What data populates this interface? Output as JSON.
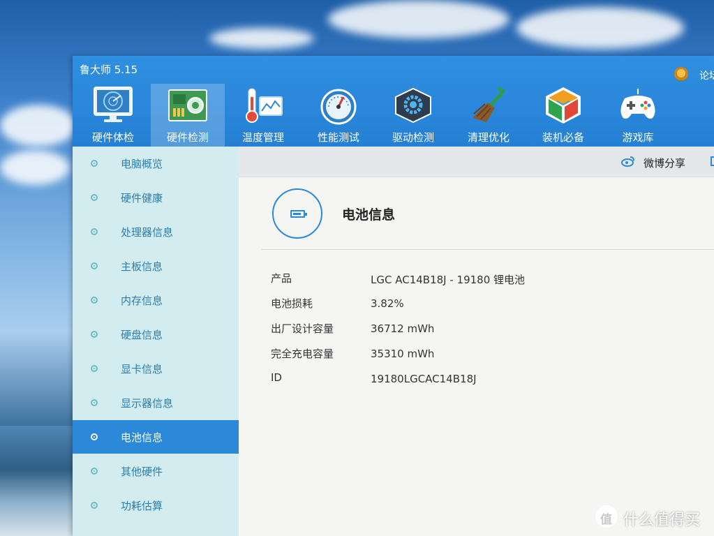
{
  "window": {
    "title": "鲁大师 5.15",
    "forum_link": "论坛"
  },
  "toolbar": {
    "items": [
      {
        "label": "硬件体检",
        "icon": "radar-icon"
      },
      {
        "label": "硬件检测",
        "icon": "circuit-board-icon"
      },
      {
        "label": "温度管理",
        "icon": "thermometer-icon"
      },
      {
        "label": "性能测试",
        "icon": "speedometer-icon"
      },
      {
        "label": "驱动检测",
        "icon": "gear-icon"
      },
      {
        "label": "清理优化",
        "icon": "broom-icon"
      },
      {
        "label": "装机必备",
        "icon": "package-cube-icon"
      },
      {
        "label": "游戏库",
        "icon": "gamepad-icon"
      }
    ],
    "active": "硬件检测"
  },
  "sidebar": {
    "items": [
      {
        "label": "电脑概览"
      },
      {
        "label": "硬件健康"
      },
      {
        "label": "处理器信息"
      },
      {
        "label": "主板信息"
      },
      {
        "label": "内存信息"
      },
      {
        "label": "硬盘信息"
      },
      {
        "label": "显卡信息"
      },
      {
        "label": "显示器信息"
      },
      {
        "label": "电池信息"
      },
      {
        "label": "其他硬件"
      },
      {
        "label": "功耗估算"
      }
    ],
    "active": "电池信息"
  },
  "subbar": {
    "share_label": "微博分享"
  },
  "main": {
    "section_title": "电池信息",
    "rows": [
      {
        "key": "产品",
        "value": "LGC AC14B18J - 19180 锂电池"
      },
      {
        "key": "电池损耗",
        "value": "3.82%"
      },
      {
        "key": "出厂设计容量",
        "value": "36712 mWh"
      },
      {
        "key": "完全充电容量",
        "value": "35310 mWh"
      },
      {
        "key": "ID",
        "value": "19180LGCAC14B18J"
      }
    ]
  },
  "watermark": {
    "text": "什么值得买"
  },
  "colors": {
    "accent": "#2c88d8",
    "titlebar": "#2a86da",
    "sidebar_bg": "#d3ecf0",
    "sidebar_text": "#2a7fb2"
  }
}
